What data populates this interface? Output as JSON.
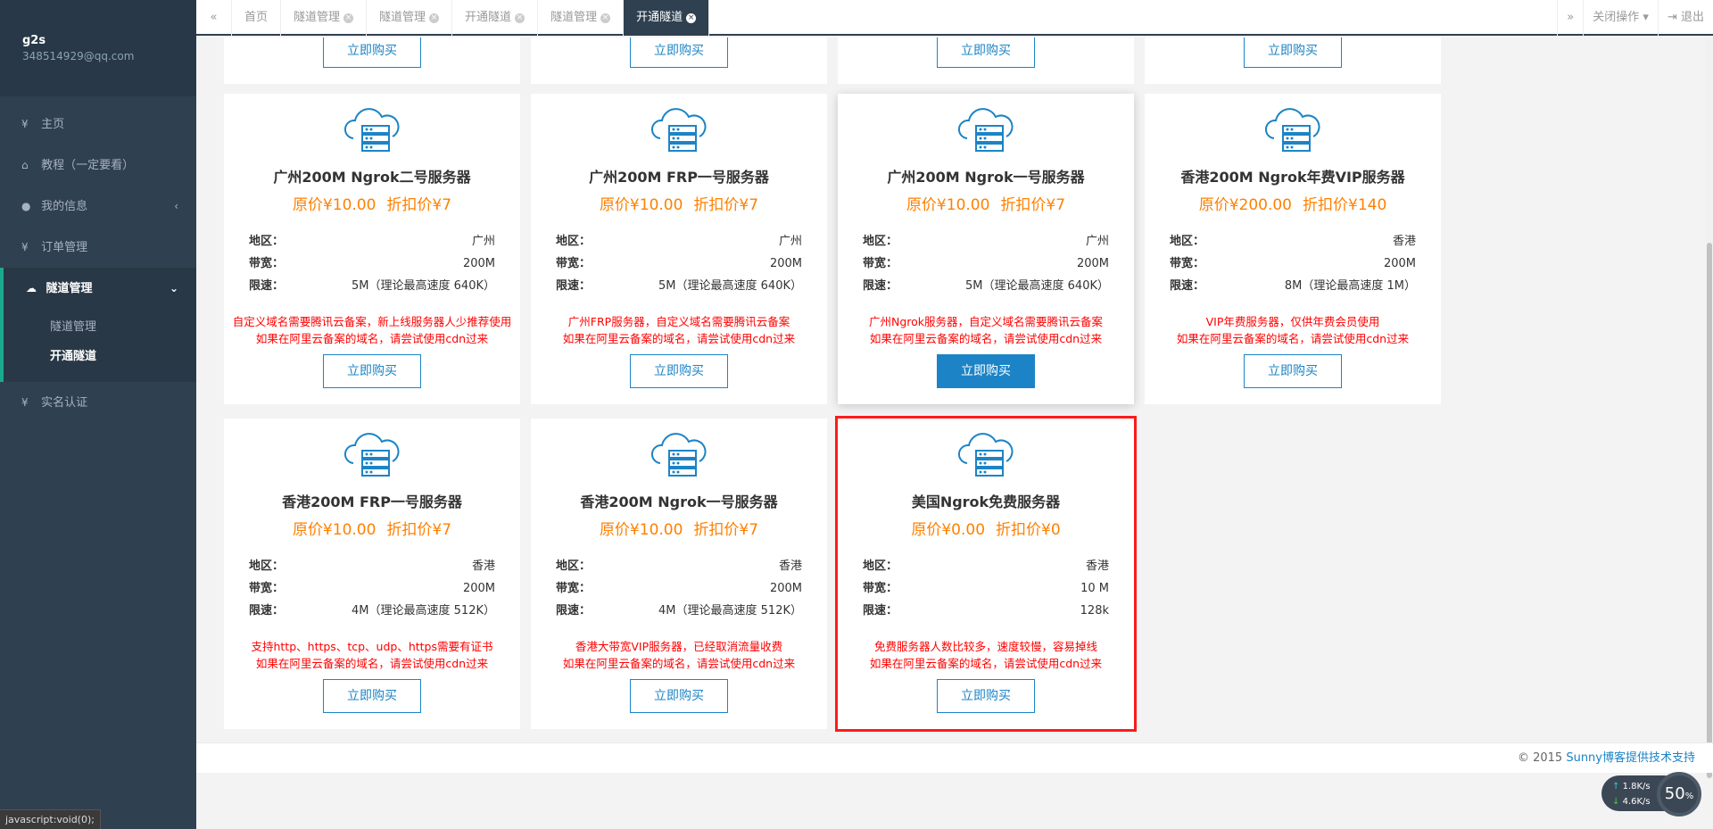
{
  "user": {
    "name": "g2s",
    "email": "348514929@qq.com"
  },
  "nav": [
    {
      "icon": "yen-icon",
      "glyph": "¥",
      "label": "主页"
    },
    {
      "icon": "home-icon",
      "glyph": "⌂",
      "label": "教程（一定要看）"
    },
    {
      "icon": "user-icon",
      "glyph": "●",
      "label": "我的信息",
      "chev": "‹"
    },
    {
      "icon": "yen-icon",
      "glyph": "¥",
      "label": "订单管理"
    }
  ],
  "tunnel_nav": {
    "glyph": "☁",
    "label": "隧道管理",
    "chev": "⌄",
    "subs": [
      "隧道管理",
      "开通隧道"
    ]
  },
  "realname_nav": {
    "glyph": "¥",
    "label": "实名认证"
  },
  "status_bar": "javascript:void(0);",
  "tabs": [
    {
      "label": "首页",
      "closable": false
    },
    {
      "label": "隧道管理",
      "closable": true
    },
    {
      "label": "隧道管理",
      "closable": true
    },
    {
      "label": "开通隧道",
      "closable": true
    },
    {
      "label": "隧道管理",
      "closable": true
    },
    {
      "label": "开通隧道",
      "closable": true,
      "active": true
    }
  ],
  "topbar": {
    "back": "«",
    "forward": "»",
    "close_ops": "关闭操作",
    "logout": "退出"
  },
  "buy_label": "立即购买",
  "spec_labels": {
    "region": "地区：",
    "bandwidth": "带宽：",
    "limit": "限速："
  },
  "cards": [
    {
      "title": "广州200M Ngrok二号服务器",
      "orig": "原价¥10.00",
      "disc": "折扣价¥7",
      "region": "广州",
      "bandwidth": "200M",
      "limit": "5M（理论最高速度 640K）",
      "note1": "自定义域名需要腾讯云备案，新上线服务器人少推荐使用",
      "note2": "如果在阿里云备案的域名，请尝试使用cdn过来"
    },
    {
      "title": "广州200M FRP一号服务器",
      "orig": "原价¥10.00",
      "disc": "折扣价¥7",
      "region": "广州",
      "bandwidth": "200M",
      "limit": "5M（理论最高速度 640K）",
      "note1": "广州FRP服务器，自定义域名需要腾讯云备案",
      "note2": "如果在阿里云备案的域名，请尝试使用cdn过来"
    },
    {
      "title": "广州200M Ngrok一号服务器",
      "orig": "原价¥10.00",
      "disc": "折扣价¥7",
      "region": "广州",
      "bandwidth": "200M",
      "limit": "5M（理论最高速度 640K）",
      "note1": "广州Ngrok服务器，自定义域名需要腾讯云备案",
      "note2": "如果在阿里云备案的域名，请尝试使用cdn过来"
    },
    {
      "title": "香港200M Ngrok年费VIP服务器",
      "orig": "原价¥200.00",
      "disc": "折扣价¥140",
      "region": "香港",
      "bandwidth": "200M",
      "limit": "8M（理论最高速度 1M）",
      "note1": "VIP年费服务器，仅供年费会员使用",
      "note2": "如果在阿里云备案的域名，请尝试使用cdn过来"
    },
    {
      "title": "香港200M FRP一号服务器",
      "orig": "原价¥10.00",
      "disc": "折扣价¥7",
      "region": "香港",
      "bandwidth": "200M",
      "limit": "4M（理论最高速度 512K）",
      "note1": "支持http、https、tcp、udp、https需要有证书",
      "note2": "如果在阿里云备案的域名，请尝试使用cdn过来"
    },
    {
      "title": "香港200M Ngrok一号服务器",
      "orig": "原价¥10.00",
      "disc": "折扣价¥7",
      "region": "香港",
      "bandwidth": "200M",
      "limit": "4M（理论最高速度 512K）",
      "note1": "香港大带宽VIP服务器，已经取消流量收费",
      "note2": "如果在阿里云备案的域名，请尝试使用cdn过来"
    },
    {
      "title": "美国Ngrok免费服务器",
      "orig": "原价¥0.00",
      "disc": "折扣价¥0",
      "region": "香港",
      "bandwidth": "10 M",
      "limit": "128k",
      "note1": "免费服务器人数比较多，速度较慢，容易掉线",
      "note2": "如果在阿里云备案的域名，请尝试使用cdn过来"
    }
  ],
  "footer": {
    "prefix": "© 2015 ",
    "link": "Sunny博客提供技术支持"
  },
  "net": {
    "up": "1.8",
    "down": "4.6",
    "unit": "K/s",
    "percent": "50",
    "percent_sign": "%"
  },
  "colors": {
    "sidebar": "#2f4050",
    "accent": "#19aa8d",
    "price": "#ff8000",
    "note": "#ff0000",
    "button": "#1c84c6",
    "highlight": "#ff1a1a"
  }
}
